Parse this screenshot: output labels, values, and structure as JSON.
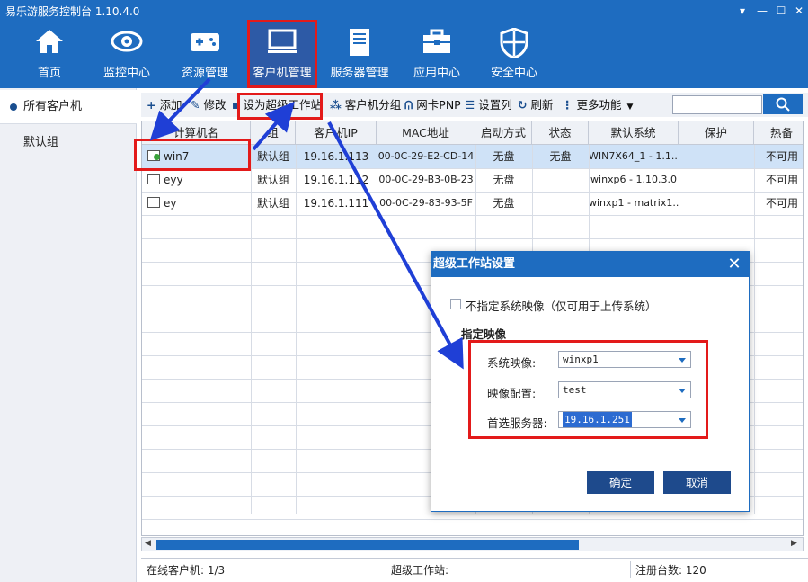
{
  "app": {
    "title": "易乐游服务控制台 1.10.4.0"
  },
  "window_controls": [
    "▾",
    "—",
    "☐",
    "✕"
  ],
  "nav": [
    {
      "label": "首页",
      "icon": "home-icon"
    },
    {
      "label": "监控中心",
      "icon": "eye-icon"
    },
    {
      "label": "资源管理",
      "icon": "gamepad-icon"
    },
    {
      "label": "客户机管理",
      "icon": "monitor-icon",
      "active": true
    },
    {
      "label": "服务器管理",
      "icon": "server-icon"
    },
    {
      "label": "应用中心",
      "icon": "toolbox-icon"
    },
    {
      "label": "安全中心",
      "icon": "shield-icon"
    }
  ],
  "sidebar": {
    "items": [
      {
        "label": "所有客户机",
        "active": true
      },
      {
        "label": "默认组"
      }
    ]
  },
  "toolbar": {
    "add": "添加",
    "edit": "修改",
    "super": "设为超级工作站",
    "group": "客户机分组",
    "pnp": "网卡PNP",
    "columns": "设置列",
    "refresh": "刷新",
    "more": "更多功能"
  },
  "search": {
    "placeholder": ""
  },
  "table": {
    "columns": [
      "计算机名",
      "组",
      "客户机IP",
      "MAC地址",
      "启动方式",
      "状态",
      "默认系统",
      "保护",
      "热备"
    ],
    "rows": [
      {
        "name": "win7",
        "group": "默认组",
        "ip": "19.16.1.113",
        "mac": "00-0C-29-E2-CD-14",
        "boot": "无盘",
        "status": "无盘",
        "system": "WIN7X64_1 - 1.1...",
        "protect": "",
        "hot": "不可用",
        "selected": true
      },
      {
        "name": "eyy",
        "group": "默认组",
        "ip": "19.16.1.112",
        "mac": "00-0C-29-B3-0B-23",
        "boot": "无盘",
        "status": "",
        "system": "winxp6 - 1.10.3.0",
        "protect": "",
        "hot": "不可用"
      },
      {
        "name": "ey",
        "group": "默认组",
        "ip": "19.16.1.111",
        "mac": "00-0C-29-83-93-5F",
        "boot": "无盘",
        "status": "",
        "system": "winxp1 - matrix1....",
        "protect": "",
        "hot": "不可用"
      }
    ]
  },
  "statusbar": {
    "online": "在线客户机: 1/3",
    "super": "超级工作站:",
    "registered": "注册台数: 120"
  },
  "dialog": {
    "title": "超级工作站设置",
    "checkbox_label": "不指定系统映像（仅可用于上传系统）",
    "section": "指定映像",
    "fields": [
      {
        "label": "系统映像:",
        "value": "winxp1"
      },
      {
        "label": "映像配置:",
        "value": "test"
      },
      {
        "label": "首选服务器:",
        "value": "19.16.1.251"
      }
    ],
    "ok": "确定",
    "cancel": "取消"
  },
  "colors": {
    "brand": "#1e6cc0",
    "annotation": "#e31a1a",
    "arrow": "#1f3fd6"
  }
}
